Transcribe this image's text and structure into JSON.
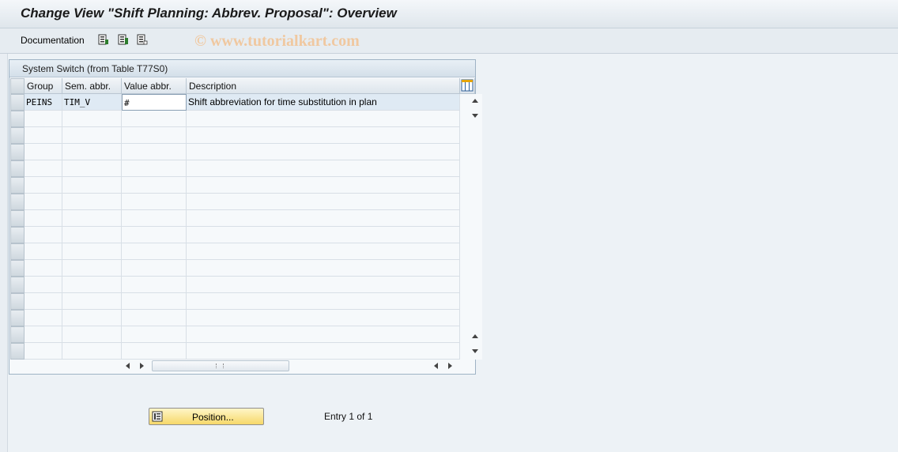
{
  "window": {
    "title": "Change View \"Shift Planning: Abbrev. Proposal\": Overview"
  },
  "toolbar": {
    "documentation_label": "Documentation",
    "icons": [
      "select-all-icon",
      "select-block-icon",
      "deselect-all-icon"
    ],
    "watermark": "© www.tutorialkart.com"
  },
  "table": {
    "title": "System Switch (from Table T77S0)",
    "columns": [
      "Group",
      "Sem. abbr.",
      "Value abbr.",
      "Description"
    ],
    "config_icon": "table-settings-icon",
    "rows": [
      {
        "group": "PEINS",
        "sem_abbr": "TIM_V",
        "value_abbr": "#",
        "description": "Shift abbreviation for time substitution in plan"
      }
    ]
  },
  "footer": {
    "position_button_label": "Position...",
    "entry_text": "Entry 1 of 1"
  },
  "colors": {
    "accent_button": "#f6d869",
    "frame_border": "#9fb3c5",
    "selected_row": "#dfeaf4"
  }
}
